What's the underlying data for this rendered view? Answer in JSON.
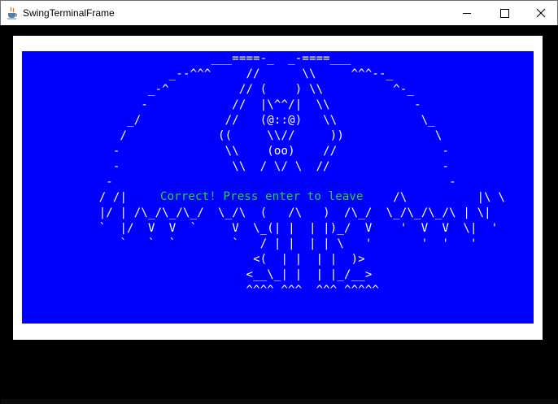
{
  "window": {
    "title": "SwingTerminalFrame",
    "icon": "java-cup-icon",
    "controls": {
      "minimize_icon": "minimize-icon",
      "maximize_icon": "maximize-icon",
      "close_label": "✕"
    }
  },
  "terminal": {
    "background": "#0000ff",
    "foreground": "#ffffff",
    "highlight": "#24d334",
    "ascii_art": "                           ___====-_  _-====___\n                     _--^^^     //      \\\\     ^^^--_\n                  _-^          // (    ) \\\\          ^-_\n                 -            //  |\\^^/|  \\\\            -\n               _/            //   (@::@)   \\\\            \\_\n              /             ((     \\\\//     ))             \\\n             -               \\\\    (oo)    //               -\n             -                \\\\  / \\/ \\  //                -\n            -                                                -\n           / /|            /\\       (        )       /\\          |\\ \\\n           |/ | /\\_/\\_/\\_/  \\_/\\  (   /\\   )  /\\_/  \\_/\\_/\\_/\\ | \\|\n           `  |/  V  V  `     V  \\_(| |  | |)_/  V    '  V  V  \\|  '\n              `   `  `        `   / | |  | | \\   '       '  '   '\n                                 <(  | |  | |  )>\n                                <__\\_| |  | |_/__>\n                                ^^^^ ^^^  ^^^ ^^^^^",
    "message": "Correct! Press enter to leave"
  }
}
